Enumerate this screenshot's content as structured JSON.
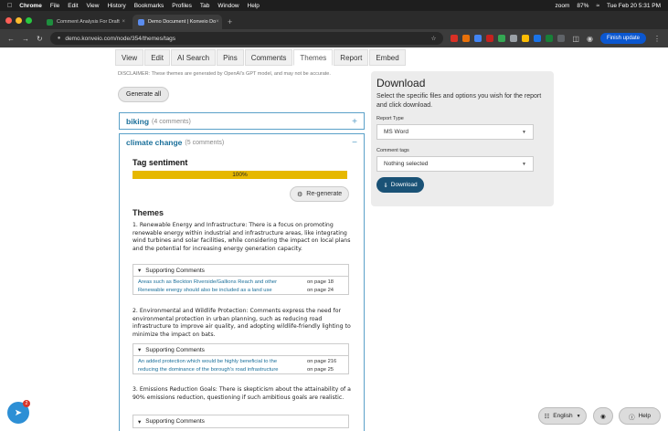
{
  "menubar": {
    "app": "Chrome",
    "items": [
      "File",
      "Edit",
      "View",
      "History",
      "Bookmarks",
      "Profiles",
      "Tab",
      "Window",
      "Help"
    ],
    "zoom": "zoom",
    "battery": "87%",
    "clock": "Tue Feb 20  5:31 PM"
  },
  "browser": {
    "tabs": [
      {
        "title": "Comment Analysis For Draft",
        "favicon_color": "#1e8e3e",
        "active": false
      },
      {
        "title": "Demo Document | Konveio Do",
        "favicon_color": "#5b8def",
        "active": true
      }
    ],
    "url": "demo.konveio.com/node/354/themes/tags",
    "finish_update": "Finish update"
  },
  "page_tabs": [
    "View",
    "Edit",
    "AI Search",
    "Pins",
    "Comments",
    "Themes",
    "Report",
    "Embed"
  ],
  "active_tab": "Themes",
  "disclaimer": "DISCLAIMER: These themes are generated by OpenAI's GPT model, and may not be accurate.",
  "generate_all": "Generate all",
  "groups": {
    "biking": {
      "name": "biking",
      "count": "(4 comments)",
      "toggle": "+"
    },
    "climate": {
      "name": "climate change",
      "count": "(5 comments)",
      "toggle": "−",
      "sentiment_title": "Tag sentiment",
      "sentiment_value": "100%",
      "sentiment_fraction": 1.0,
      "regenerate": "Re-generate",
      "themes_title": "Themes",
      "themes": [
        {
          "text": "1. Renewable Energy and Infrastructure: There is a focus on promoting renewable energy within industrial and infrastructure areas, like integrating wind turbines and solar facilities, while considering the impact on local plans and the potential for increasing energy generation capacity.",
          "supporting_label": "Supporting Comments",
          "comments": [
            {
              "text": "Areas such as Beckton Riverside/Gallions Reach and other",
              "page": "on page 18"
            },
            {
              "text": "Renewable energy should also be included as a land use",
              "page": "on page 24"
            }
          ]
        },
        {
          "text": "2. Environmental and Wildlife Protection: Comments express the need for environmental protection in urban planning, such as reducing road infrastructure to improve air quality, and adopting wildlife-friendly lighting to minimize the impact on bats.",
          "supporting_label": "Supporting Comments",
          "comments": [
            {
              "text": "An added protection which would be highly beneficial to the",
              "page": "on page 216"
            },
            {
              "text": "reducing the dominance of the borough's road infrastructure",
              "page": "on page 25"
            }
          ]
        },
        {
          "text": "3. Emissions Reduction Goals: There is skepticism about the attainability of a 90% emissions reduction, questioning if such ambitious goals are realistic.",
          "supporting_label": "Supporting Comments",
          "comments": []
        }
      ]
    }
  },
  "download": {
    "title": "Download",
    "description": "Select the specific files and options you wish for the report and click download.",
    "report_type_label": "Report Type",
    "report_type_value": "MS Word",
    "comment_tags_label": "Comment tags",
    "comment_tags_value": "Nothing selected",
    "button": "Download"
  },
  "widgets": {
    "notification_count": "2",
    "language": "English",
    "help": "Help"
  },
  "colors": {
    "accent": "#1a6f9a",
    "sentiment_bar": "#e6b800",
    "download_button": "#1a5276"
  }
}
